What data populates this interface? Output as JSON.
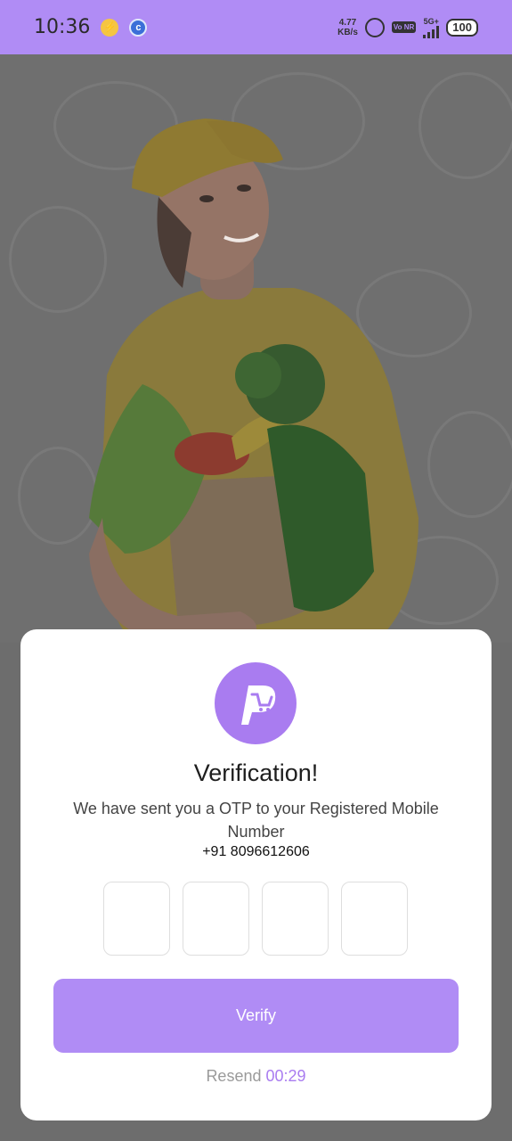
{
  "status_bar": {
    "time": "10:36",
    "speed_value": "4.77",
    "speed_unit": "KB/s",
    "volte": "Vo NR",
    "network": "5G+",
    "battery": "100"
  },
  "hero": {
    "image": "delivery-woman-with-vegetable-bag"
  },
  "card": {
    "logo_letter": "P",
    "title": "Verification!",
    "subtitle": "We have sent you a OTP to your Registered Mobile Number",
    "phone": "+91 8096612606",
    "otp_boxes": [
      "",
      "",
      "",
      ""
    ],
    "verify_label": "Verify",
    "resend_label": "Resend",
    "resend_timer": "00:29"
  },
  "colors": {
    "accent": "#b08cf5",
    "logo": "#a97cf0",
    "overlay": "#6d6d6d"
  }
}
